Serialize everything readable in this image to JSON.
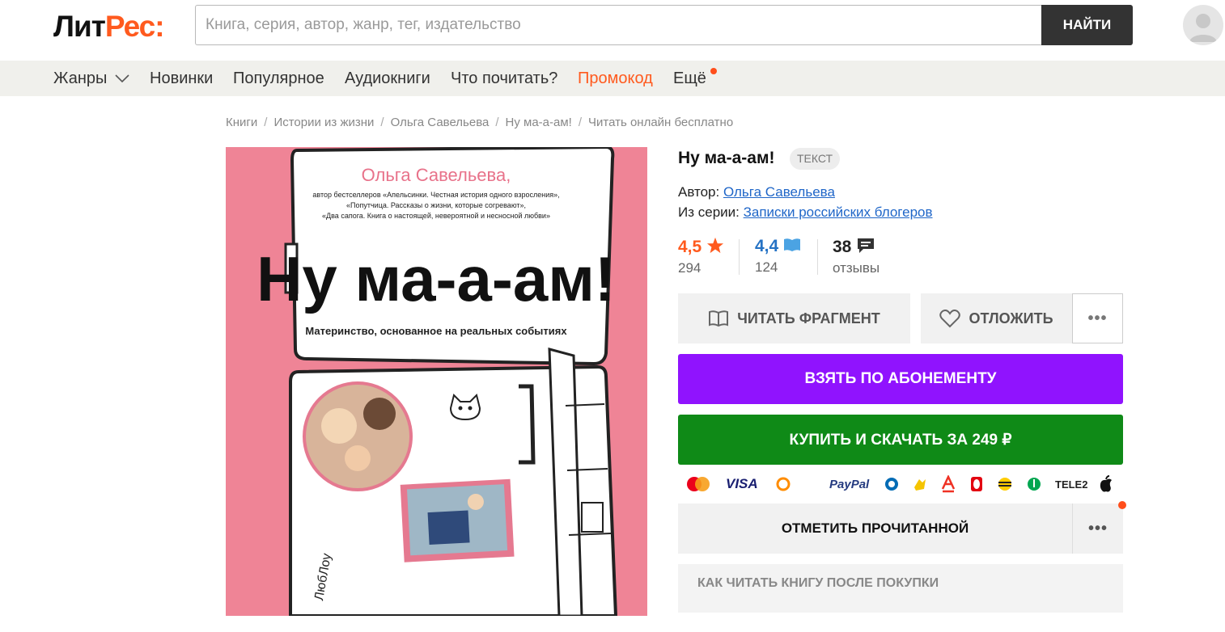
{
  "header": {
    "logo_part1": "Лит",
    "logo_part2": "Рес:",
    "search_placeholder": "Книга, серия, автор, жанр, тег, издательство",
    "search_button": "НАЙТИ"
  },
  "nav": {
    "items": [
      "Жанры",
      "Новинки",
      "Популярное",
      "Аудиокниги",
      "Что почитать?",
      "Промокод",
      "Ещё"
    ]
  },
  "breadcrumb": [
    "Книги",
    "Истории из жизни",
    "Ольга Савельева",
    "Ну ма-а-ам!",
    "Читать онлайн бесплатно"
  ],
  "cover": {
    "author": "Ольга Савельева,",
    "subtitle_lines": [
      "автор бестселлеров «Апельсинки. Честная история одного взросления»,",
      "«Попутчица. Рассказы о жизни, которые согревают»,",
      "«Два сапога. Книга о настоящей, невероятной и несносной любви»"
    ],
    "title": "Ну ма-а-ам!",
    "tagline": "Материнство, основанное на реальных событиях",
    "publisher": "ЛюбЛоу"
  },
  "book": {
    "title": "Ну ма-а-ам!",
    "format_badge": "ТЕКСТ",
    "author_label": "Автор:",
    "author": "Ольга Савельева",
    "series_label": "Из серии:",
    "series": "Записки российских блогеров"
  },
  "ratings": {
    "litres_rating": "4,5",
    "litres_count": "294",
    "livelib_rating": "4,4",
    "livelib_count": "124",
    "reviews_count": "38",
    "reviews_label": "отзывы"
  },
  "actions": {
    "read_fragment": "ЧИТАТЬ ФРАГМЕНТ",
    "postpone": "ОТЛОЖИТЬ",
    "subscribe": "ВЗЯТЬ ПО АБОНЕМЕНТУ",
    "buy": "КУПИТЬ И СКАЧАТЬ ЗА 249 ₽",
    "mark_read": "ОТМЕТИТЬ ПРОЧИТАННОЙ",
    "how_to_read": "КАК ЧИТАТЬ КНИГУ ПОСЛЕ ПОКУПКИ",
    "more": "•••"
  },
  "payments": {
    "visa": "VISA",
    "paypal": "PayPal",
    "tele2": "TELE2",
    "qiwi": "QIWI WALLET"
  },
  "colors": {
    "brand": "#ff5a1e",
    "subscribe": "#9013fe",
    "buy": "#0f8a17",
    "link": "#1f66c8"
  }
}
